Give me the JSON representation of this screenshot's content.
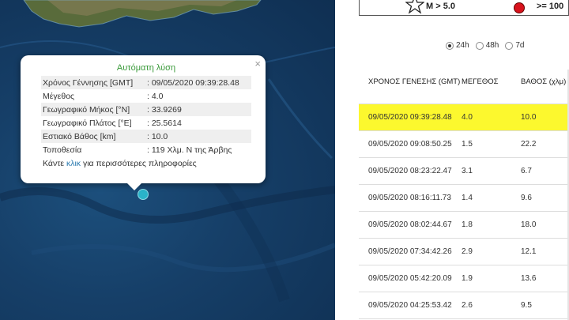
{
  "popup": {
    "title": "Αυτόματη λύση",
    "rows": [
      {
        "label": "Χρόνος Γέννησης [GMT]",
        "value": ": 09/05/2020 09:39:28.48"
      },
      {
        "label": "Μέγεθος",
        "value": ": 4.0"
      },
      {
        "label": "Γεωγραφικό Μήκος [°N]",
        "value": ": 33.9269"
      },
      {
        "label": "Γεωγραφικό Πλάτος [°E]",
        "value": ": 25.5614"
      },
      {
        "label": "Εστιακό Βάθος [km]",
        "value": ": 10.0"
      },
      {
        "label": "Τοποθεσία",
        "value": ": 119 Χλμ. N της Άρβης"
      }
    ],
    "more_prefix": "Κάντε ",
    "more_link": "κλικ",
    "more_suffix": " για περισσότερες πληροφορίες",
    "close": "×"
  },
  "legend": {
    "magnitude": "M > 5.0",
    "depth": ">= 100",
    "dot_color": "#d8121c"
  },
  "filters": [
    {
      "label": "24h",
      "selected": true
    },
    {
      "label": "48h",
      "selected": false
    },
    {
      "label": "7d",
      "selected": false
    }
  ],
  "table": {
    "headers": {
      "time": "ΧΡΟΝΟΣ ΓΕΝΕΣΗΣ (GMT)",
      "magnitude": "ΜΕΓΕΘΟΣ",
      "depth": "ΒΑΘΟΣ (χλμ)"
    },
    "rows": [
      {
        "time": "09/05/2020 09:39:28.48",
        "magnitude": "4.0",
        "depth": "10.0",
        "highlighted": true
      },
      {
        "time": "09/05/2020 09:08:50.25",
        "magnitude": "1.5",
        "depth": "22.2"
      },
      {
        "time": "09/05/2020 08:23:22.47",
        "magnitude": "3.1",
        "depth": "6.7"
      },
      {
        "time": "09/05/2020 08:16:11.73",
        "magnitude": "1.4",
        "depth": "9.6"
      },
      {
        "time": "09/05/2020 08:02:44.67",
        "magnitude": "1.8",
        "depth": "18.0"
      },
      {
        "time": "09/05/2020 07:34:42.26",
        "magnitude": "2.9",
        "depth": "12.1"
      },
      {
        "time": "09/05/2020 05:42:20.09",
        "magnitude": "1.9",
        "depth": "13.6"
      },
      {
        "time": "09/05/2020 04:25:53.42",
        "magnitude": "2.6",
        "depth": "9.5"
      }
    ],
    "highlight_color": "#fcf82e"
  },
  "colors": {
    "sea": "#163f68",
    "land": "#5a6a3a",
    "marker": "#2ab3c9",
    "popup_title": "#3a9a3a",
    "link": "#2a7ab0"
  }
}
